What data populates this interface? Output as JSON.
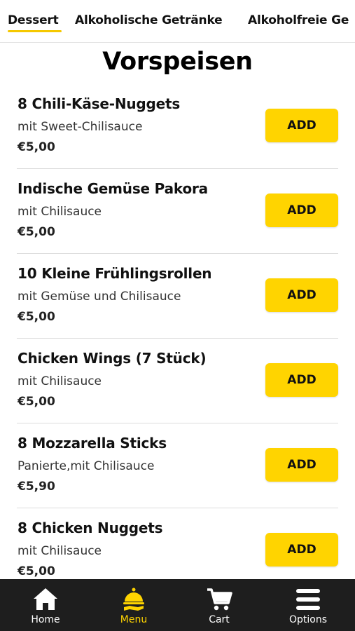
{
  "tabs": [
    {
      "label": "Dessert",
      "active": true
    },
    {
      "label": "Alkoholische Getränke",
      "active": false
    },
    {
      "label": "Alkoholfreie Ge",
      "active": false
    }
  ],
  "section": {
    "title": "Vorspeisen"
  },
  "items": [
    {
      "name": "8 Chili-Käse-Nuggets",
      "desc": "mit Sweet-Chilisauce",
      "price": "€5,00",
      "button": "ADD"
    },
    {
      "name": "Indische Gemüse Pakora",
      "desc": "mit Chilisauce",
      "price": "€5,00",
      "button": "ADD"
    },
    {
      "name": "10 Kleine Frühlingsrollen",
      "desc": "mit Gemüse und Chilisauce",
      "price": "€5,00",
      "button": "ADD"
    },
    {
      "name": "Chicken Wings (7 Stück)",
      "desc": "mit Chilisauce",
      "price": "€5,00",
      "button": "ADD"
    },
    {
      "name": "8 Mozzarella Sticks",
      "desc": "Panierte,mit Chilisauce",
      "price": "€5,90",
      "button": "ADD"
    },
    {
      "name": "8 Chicken Nuggets",
      "desc": "mit Chilisauce",
      "price": "€5,00",
      "button": "ADD"
    }
  ],
  "nav": [
    {
      "label": "Home",
      "icon": "home-icon",
      "active": false
    },
    {
      "label": "Menu",
      "icon": "food-service-icon",
      "active": true
    },
    {
      "label": "Cart",
      "icon": "cart-icon",
      "active": false
    },
    {
      "label": "Options",
      "icon": "menu-lines-icon",
      "active": false
    }
  ],
  "colors": {
    "accent": "#ffd400",
    "nav_bg": "#1e1e1e",
    "text": "#111111"
  }
}
